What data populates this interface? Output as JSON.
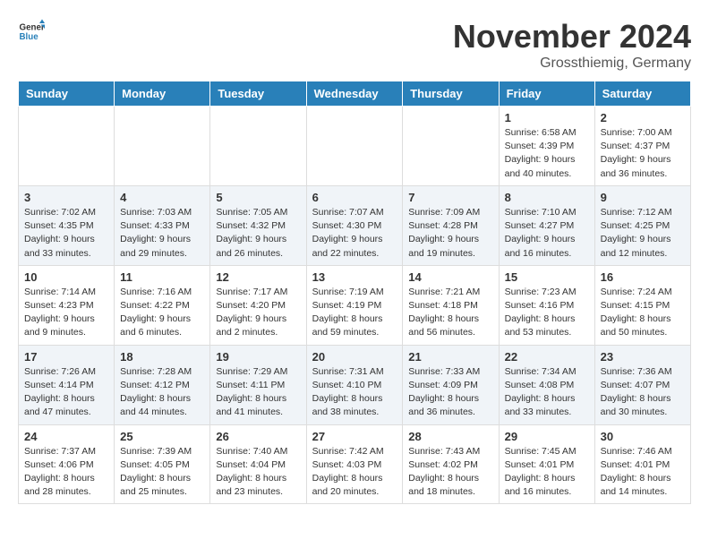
{
  "header": {
    "logo_general": "General",
    "logo_blue": "Blue",
    "month": "November 2024",
    "location": "Grossthiemig, Germany"
  },
  "weekdays": [
    "Sunday",
    "Monday",
    "Tuesday",
    "Wednesday",
    "Thursday",
    "Friday",
    "Saturday"
  ],
  "weeks": [
    [
      {
        "day": "",
        "info": ""
      },
      {
        "day": "",
        "info": ""
      },
      {
        "day": "",
        "info": ""
      },
      {
        "day": "",
        "info": ""
      },
      {
        "day": "",
        "info": ""
      },
      {
        "day": "1",
        "info": "Sunrise: 6:58 AM\nSunset: 4:39 PM\nDaylight: 9 hours\nand 40 minutes."
      },
      {
        "day": "2",
        "info": "Sunrise: 7:00 AM\nSunset: 4:37 PM\nDaylight: 9 hours\nand 36 minutes."
      }
    ],
    [
      {
        "day": "3",
        "info": "Sunrise: 7:02 AM\nSunset: 4:35 PM\nDaylight: 9 hours\nand 33 minutes."
      },
      {
        "day": "4",
        "info": "Sunrise: 7:03 AM\nSunset: 4:33 PM\nDaylight: 9 hours\nand 29 minutes."
      },
      {
        "day": "5",
        "info": "Sunrise: 7:05 AM\nSunset: 4:32 PM\nDaylight: 9 hours\nand 26 minutes."
      },
      {
        "day": "6",
        "info": "Sunrise: 7:07 AM\nSunset: 4:30 PM\nDaylight: 9 hours\nand 22 minutes."
      },
      {
        "day": "7",
        "info": "Sunrise: 7:09 AM\nSunset: 4:28 PM\nDaylight: 9 hours\nand 19 minutes."
      },
      {
        "day": "8",
        "info": "Sunrise: 7:10 AM\nSunset: 4:27 PM\nDaylight: 9 hours\nand 16 minutes."
      },
      {
        "day": "9",
        "info": "Sunrise: 7:12 AM\nSunset: 4:25 PM\nDaylight: 9 hours\nand 12 minutes."
      }
    ],
    [
      {
        "day": "10",
        "info": "Sunrise: 7:14 AM\nSunset: 4:23 PM\nDaylight: 9 hours\nand 9 minutes."
      },
      {
        "day": "11",
        "info": "Sunrise: 7:16 AM\nSunset: 4:22 PM\nDaylight: 9 hours\nand 6 minutes."
      },
      {
        "day": "12",
        "info": "Sunrise: 7:17 AM\nSunset: 4:20 PM\nDaylight: 9 hours\nand 2 minutes."
      },
      {
        "day": "13",
        "info": "Sunrise: 7:19 AM\nSunset: 4:19 PM\nDaylight: 8 hours\nand 59 minutes."
      },
      {
        "day": "14",
        "info": "Sunrise: 7:21 AM\nSunset: 4:18 PM\nDaylight: 8 hours\nand 56 minutes."
      },
      {
        "day": "15",
        "info": "Sunrise: 7:23 AM\nSunset: 4:16 PM\nDaylight: 8 hours\nand 53 minutes."
      },
      {
        "day": "16",
        "info": "Sunrise: 7:24 AM\nSunset: 4:15 PM\nDaylight: 8 hours\nand 50 minutes."
      }
    ],
    [
      {
        "day": "17",
        "info": "Sunrise: 7:26 AM\nSunset: 4:14 PM\nDaylight: 8 hours\nand 47 minutes."
      },
      {
        "day": "18",
        "info": "Sunrise: 7:28 AM\nSunset: 4:12 PM\nDaylight: 8 hours\nand 44 minutes."
      },
      {
        "day": "19",
        "info": "Sunrise: 7:29 AM\nSunset: 4:11 PM\nDaylight: 8 hours\nand 41 minutes."
      },
      {
        "day": "20",
        "info": "Sunrise: 7:31 AM\nSunset: 4:10 PM\nDaylight: 8 hours\nand 38 minutes."
      },
      {
        "day": "21",
        "info": "Sunrise: 7:33 AM\nSunset: 4:09 PM\nDaylight: 8 hours\nand 36 minutes."
      },
      {
        "day": "22",
        "info": "Sunrise: 7:34 AM\nSunset: 4:08 PM\nDaylight: 8 hours\nand 33 minutes."
      },
      {
        "day": "23",
        "info": "Sunrise: 7:36 AM\nSunset: 4:07 PM\nDaylight: 8 hours\nand 30 minutes."
      }
    ],
    [
      {
        "day": "24",
        "info": "Sunrise: 7:37 AM\nSunset: 4:06 PM\nDaylight: 8 hours\nand 28 minutes."
      },
      {
        "day": "25",
        "info": "Sunrise: 7:39 AM\nSunset: 4:05 PM\nDaylight: 8 hours\nand 25 minutes."
      },
      {
        "day": "26",
        "info": "Sunrise: 7:40 AM\nSunset: 4:04 PM\nDaylight: 8 hours\nand 23 minutes."
      },
      {
        "day": "27",
        "info": "Sunrise: 7:42 AM\nSunset: 4:03 PM\nDaylight: 8 hours\nand 20 minutes."
      },
      {
        "day": "28",
        "info": "Sunrise: 7:43 AM\nSunset: 4:02 PM\nDaylight: 8 hours\nand 18 minutes."
      },
      {
        "day": "29",
        "info": "Sunrise: 7:45 AM\nSunset: 4:01 PM\nDaylight: 8 hours\nand 16 minutes."
      },
      {
        "day": "30",
        "info": "Sunrise: 7:46 AM\nSunset: 4:01 PM\nDaylight: 8 hours\nand 14 minutes."
      }
    ]
  ]
}
